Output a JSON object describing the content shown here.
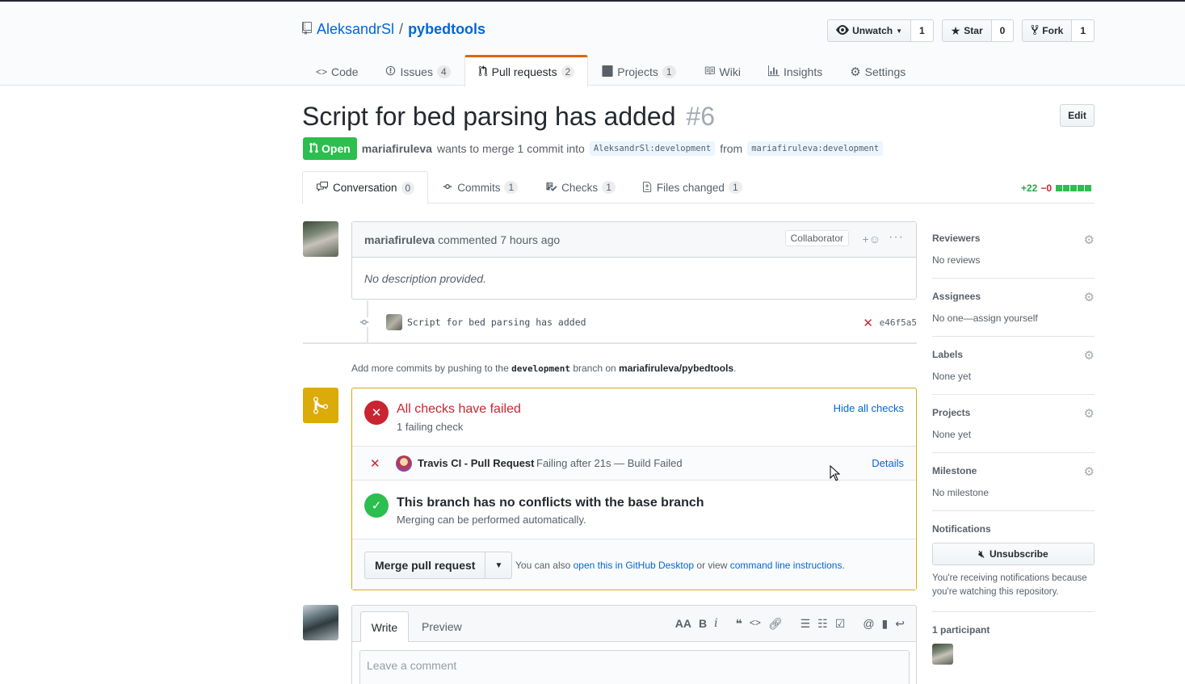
{
  "repo": {
    "owner": "AleksandrSl",
    "separator": "/",
    "name": "pybedtools"
  },
  "actions": {
    "watch": {
      "label": "Unwatch",
      "count": "1"
    },
    "star": {
      "label": "Star",
      "count": "0"
    },
    "fork": {
      "label": "Fork",
      "count": "1"
    }
  },
  "reponav": [
    {
      "label": "Code",
      "icon": "code-icon",
      "count": ""
    },
    {
      "label": "Issues",
      "icon": "issue-icon",
      "count": "4"
    },
    {
      "label": "Pull requests",
      "icon": "pr-icon",
      "count": "2"
    },
    {
      "label": "Projects",
      "icon": "project-icon",
      "count": "1"
    },
    {
      "label": "Wiki",
      "icon": "book-icon",
      "count": ""
    },
    {
      "label": "Insights",
      "icon": "graph-icon",
      "count": ""
    },
    {
      "label": "Settings",
      "icon": "gear-icon",
      "count": ""
    }
  ],
  "pr": {
    "title": "Script for bed parsing has added",
    "number": "#6",
    "edit_label": "Edit",
    "state": "Open",
    "author": "mariafiruleva",
    "merge_text": "wants to merge 1 commit into",
    "base_ref": "AleksandrSl:development",
    "from_text": "from",
    "head_ref": "mariafiruleva:development"
  },
  "tabs": [
    {
      "label": "Conversation",
      "count": "0"
    },
    {
      "label": "Commits",
      "count": "1"
    },
    {
      "label": "Checks",
      "count": "1"
    },
    {
      "label": "Files changed",
      "count": "1"
    }
  ],
  "diffstat": {
    "additions": "+22",
    "deletions": "−0"
  },
  "comment": {
    "author": "mariafiruleva",
    "action": "commented 7 hours ago",
    "role": "Collaborator",
    "reaction": "+☺",
    "more": "···",
    "body": "No description provided."
  },
  "commit": {
    "message": "Script for bed parsing has added",
    "sha": "e46f5a5"
  },
  "push_hint": {
    "prefix": "Add more commits by pushing to the",
    "branch": "development",
    "middle": "branch on",
    "repo": "mariafiruleva/pybedtools",
    "suffix": "."
  },
  "merge": {
    "checks_title": "All checks have failed",
    "checks_sub": "1 failing check",
    "hide_checks": "Hide all checks",
    "check_name": "Travis CI - Pull Request",
    "check_desc": "Failing after 21s — Build Failed",
    "check_details": "Details",
    "conflict_title": "This branch has no conflicts with the base branch",
    "conflict_sub": "Merging can be performed automatically.",
    "merge_button": "Merge pull request",
    "alt_prefix": "You can also",
    "alt_link1": "open this in GitHub Desktop",
    "alt_middle": "or view",
    "alt_link2": "command line instructions."
  },
  "new_comment": {
    "write": "Write",
    "preview": "Preview",
    "placeholder": "Leave a comment"
  },
  "sidebar": {
    "reviewers": {
      "heading": "Reviewers",
      "value": "No reviews"
    },
    "assignees": {
      "heading": "Assignees",
      "value": "No one—assign yourself"
    },
    "labels": {
      "heading": "Labels",
      "value": "None yet"
    },
    "projects": {
      "heading": "Projects",
      "value": "None yet"
    },
    "milestone": {
      "heading": "Milestone",
      "value": "No milestone"
    },
    "notifications": {
      "heading": "Notifications",
      "button": "Unsubscribe",
      "reason": "You're receiving notifications because you're watching this repository."
    },
    "participants": {
      "heading": "1 participant"
    }
  },
  "colors": {
    "accent_orange": "#e36209",
    "open_green": "#2cbe4e",
    "fail_red": "#cb2431",
    "merge_yellow": "#dbab09",
    "link_blue": "#0366d6"
  }
}
